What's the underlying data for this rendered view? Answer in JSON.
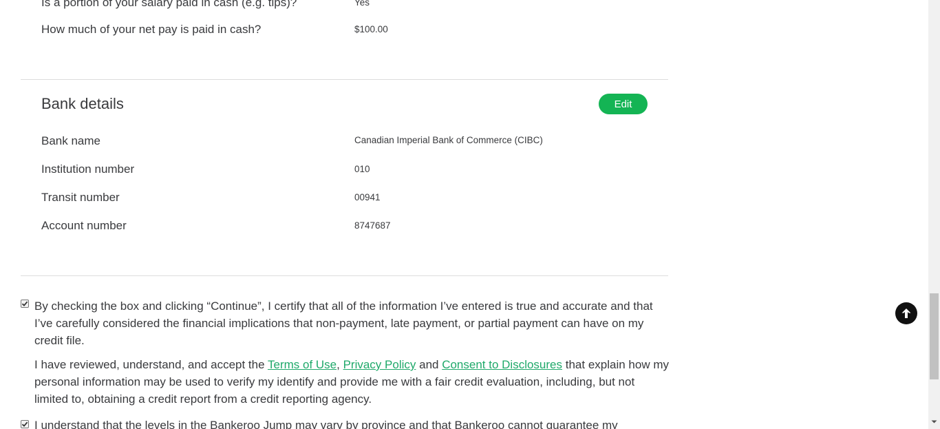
{
  "income": {
    "rows": [
      {
        "label": "Is a portion of your salary paid in cash (e.g. tips)?",
        "value": "Yes"
      },
      {
        "label": "How much of your net pay is paid in cash?",
        "value": "$100.00"
      }
    ]
  },
  "bank": {
    "title": "Bank details",
    "edit_label": "Edit",
    "rows": [
      {
        "label": "Bank name",
        "value": "Canadian Imperial Bank of Commerce (CIBC)"
      },
      {
        "label": "Institution number",
        "value": "010"
      },
      {
        "label": "Transit number",
        "value": "00941"
      },
      {
        "label": "Account number",
        "value": "8747687"
      }
    ]
  },
  "consent": {
    "certify_text": "By checking the box and clicking “Continue”, I certify that all of the information I’ve entered is true and accurate and that I’ve carefully considered the financial implications that non-payment, late payment, or partial payment can have on my credit file.",
    "review_prefix": "I have reviewed, understand, and accept the ",
    "terms_link": "Terms of Use",
    "comma": ", ",
    "privacy_link": "Privacy Policy",
    "and": " and ",
    "disclosures_link": "Consent to Disclosures",
    "review_suffix": " that explain how my personal information may be used to verify my identify and provide me with a fair credit evaluation, including, but not limited to, obtaining a credit report from a credit reporting agency.",
    "levels_text": "I understand that the levels in the Bankeroo Jump may vary by province and that Bankeroo cannot guarantee my",
    "certify_checked": true,
    "levels_checked": true
  },
  "controls": {
    "back_to_top_icon": "arrow-up-circle-icon"
  },
  "colors": {
    "accent": "#14b454",
    "link": "#1fa96a",
    "text": "#393a3d"
  }
}
